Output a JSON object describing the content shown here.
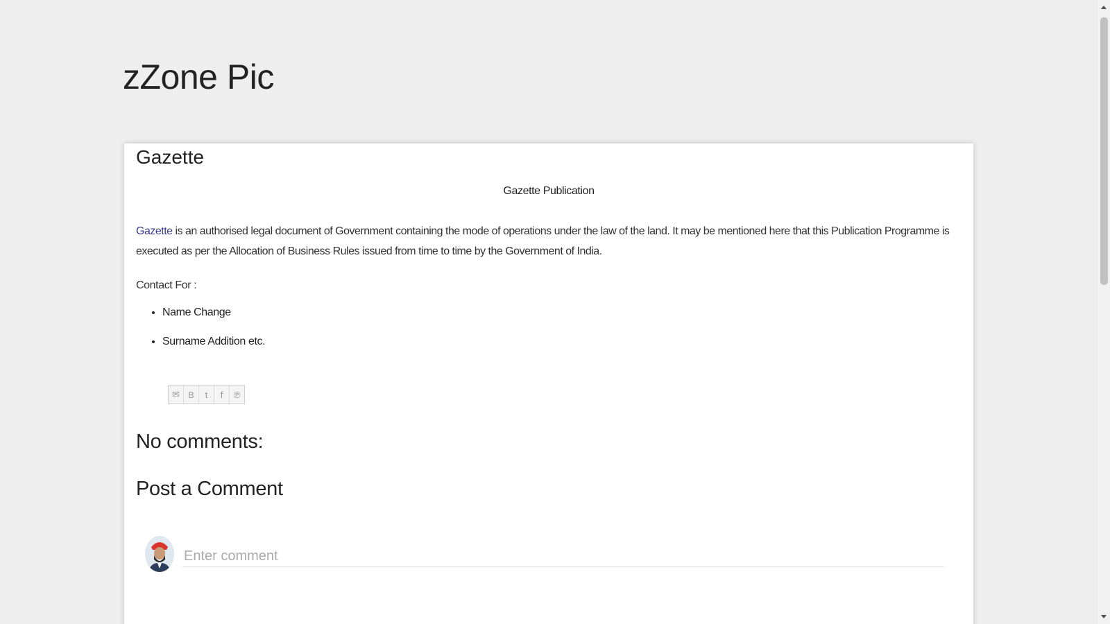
{
  "blog": {
    "title": "zZone Pic"
  },
  "post": {
    "title": "Gazette",
    "subtitle": "Gazette Publication",
    "link_text": "Gazette",
    "body_text": " is an authorised legal document of Government containing the mode of operations under the law of the land. It may be mentioned here that this Publication Programme is executed as per the Allocation of Business Rules issued from time to time by the Government of India.",
    "contact_label": "Contact For :",
    "contact_items": [
      "Name Change",
      "Surname Addition etc."
    ]
  },
  "share": [
    {
      "icon": "email-icon",
      "glyph": "✉"
    },
    {
      "icon": "blog-this-icon",
      "glyph": "B"
    },
    {
      "icon": "twitter-icon",
      "glyph": "t"
    },
    {
      "icon": "facebook-icon",
      "glyph": "f"
    },
    {
      "icon": "pinterest-icon",
      "glyph": "℗"
    }
  ],
  "comments": {
    "heading": "No comments:",
    "post_heading": "Post a Comment",
    "input_placeholder": "Enter comment",
    "input_value": ""
  },
  "colors": {
    "page_background": "#eeeeee",
    "card_background": "#ffffff",
    "link": "#3d3d8f"
  }
}
